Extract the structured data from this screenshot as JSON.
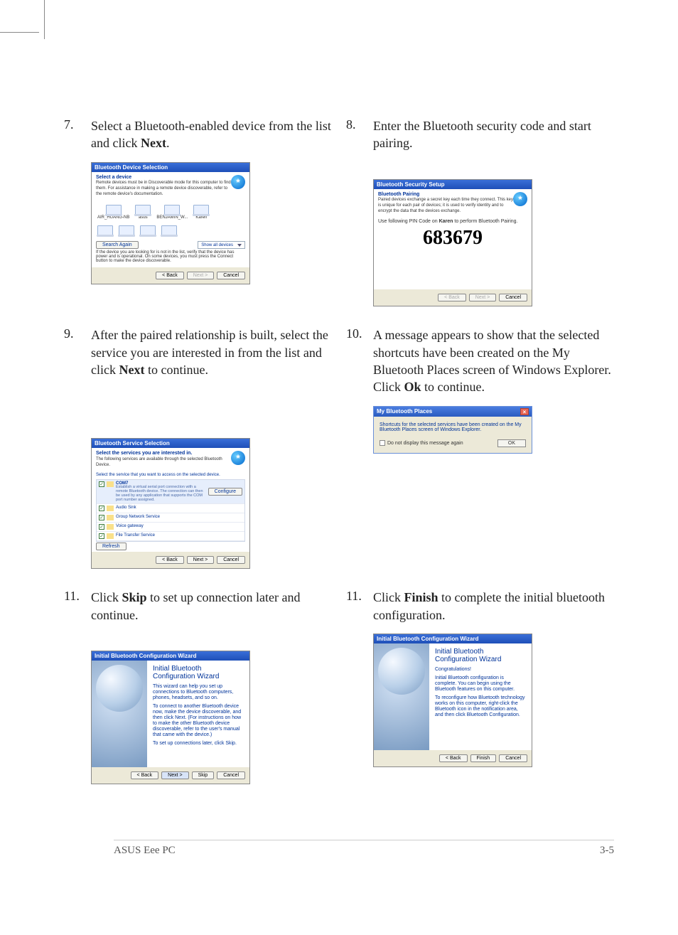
{
  "steps": {
    "s7": {
      "num": "7.",
      "text_a": "Select a Bluetooth-enabled device from the list and click ",
      "bold": "Next",
      "text_b": "."
    },
    "s8": {
      "num": "8.",
      "text_a": "Enter the Bluetooth security code and start pairing.",
      "bold": "",
      "text_b": ""
    },
    "s9": {
      "num": "9.",
      "text_a": "After the paired relationship is built, select the service you are interested in from the list and click ",
      "bold": "Next",
      "text_b": " to continue."
    },
    "s10": {
      "num": "10.",
      "text_a": "A message appears to show that the selected shortcuts have been created on the My Bluetooth Places screen of Windows Explorer. Click ",
      "bold": "Ok",
      "text_b": " to continue."
    },
    "s11l": {
      "num": "11.",
      "text_a": "Click ",
      "bold": "Skip",
      "text_b": " to set up connection later and continue."
    },
    "s11r": {
      "num": "11.",
      "text_a": "Click ",
      "bold": "Finish",
      "text_b": " to complete the initial bluetooth configuration."
    }
  },
  "dlg7": {
    "title": "Bluetooth Device Selection",
    "hdr_title": "Select a device",
    "hdr_sub": "Remote devices must be in Discoverable mode for this computer to find them. For assistance in making a remote device discoverable, refer to the remote device's documentation.",
    "devices": [
      "AIR_HUANG-NB",
      "asus",
      "BENJAMIN_W...",
      "Karen"
    ],
    "search_again": "Search Again",
    "show_all": "Show all devices",
    "note": "If the device you are looking for is not in the list, verify that the device has power and is operational. On some devices, you must press the Connect button to make the device discoverable.",
    "back": "< Back",
    "next": "Next >",
    "cancel": "Cancel"
  },
  "dlg8": {
    "title": "Bluetooth Security Setup",
    "hdr_title": "Bluetooth Pairing",
    "hdr_sub": "Paired devices exchange a secret key each time they connect. This key is unique for each pair of devices; it is used to verify identity and to encrypt the data that the devices exchange.",
    "instr_a": "Use following PIN Code on ",
    "instr_bold": "Karen",
    "instr_b": " to perform Bluetooth Pairing.",
    "pin": "683679",
    "back": "< Back",
    "next": "Next >",
    "cancel": "Cancel"
  },
  "dlg9": {
    "title": "Bluetooth Service Selection",
    "hdr_title": "Select the services you are interested in.",
    "hdr_sub": "The following services are available through the selected Bluetooth Device.",
    "instr": "Select the service that you want to access on the selected device.",
    "svc_com": "COM7",
    "svc_com_desc": "Establish a virtual serial port connection with a remote Bluetooth device. The connection can then be used by any application that supports the COM port number assigned.",
    "svc_audio": "Audio Sink",
    "svc_net": "Group Network Service",
    "svc_voice": "Voice gateway",
    "svc_ft": "File Transfer Service",
    "configure": "Configure",
    "refresh": "Refresh",
    "back": "< Back",
    "next": "Next >",
    "cancel": "Cancel"
  },
  "dlg10": {
    "title": "My Bluetooth Places",
    "body": "Shortcuts for the selected services have been created on the My Bluetooth Places screen of Windows Explorer.",
    "chk": "Do not display this message again",
    "ok": "OK"
  },
  "dlg11l": {
    "title": "Initial Bluetooth Configuration Wizard",
    "h": "Initial Bluetooth Configuration Wizard",
    "p1": "This wizard can help you set up connections to Bluetooth computers, phones, headsets, and so on.",
    "p2": "To connect to another Bluetooth device now, make the device discoverable, and then click Next. (For instructions on how to make the other Bluetooth device discoverable, refer to the user's manual that came with the device.)",
    "p3": "To set up connections later, click Skip.",
    "back": "< Back",
    "next": "Next >",
    "skip": "Skip",
    "cancel": "Cancel"
  },
  "dlg11r": {
    "title": "Initial Bluetooth Configuration Wizard",
    "h": "Initial Bluetooth Configuration Wizard",
    "p1": "Congratulations!",
    "p2": "Initial Bluetooth configuration is complete. You can begin using the Bluetooth features on this computer.",
    "p3": "To reconfigure how Bluetooth technology works on this computer, right-click the Bluetooth icon in the notification area, and then click Bluetooth Configuration.",
    "back": "< Back",
    "finish": "Finish",
    "cancel": "Cancel"
  },
  "footer": {
    "left": "ASUS Eee PC",
    "right": "3-5"
  }
}
